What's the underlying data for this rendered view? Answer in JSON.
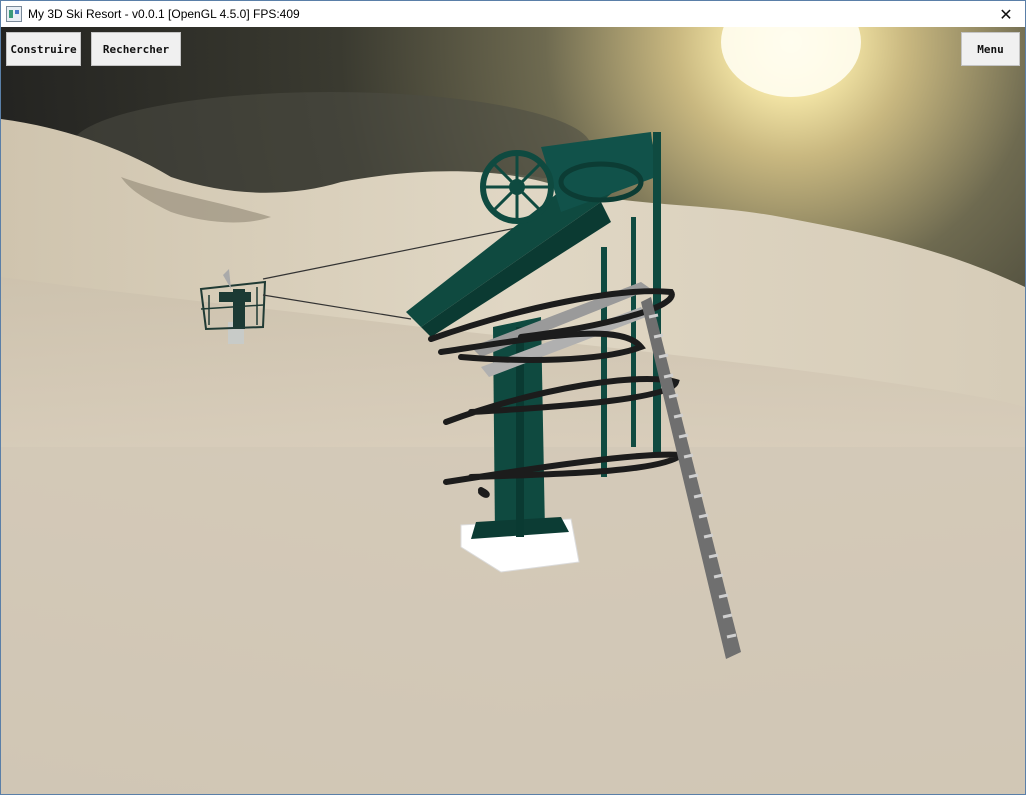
{
  "window": {
    "title": "My 3D Ski Resort - v0.0.1 [OpenGL 4.5.0] FPS:409",
    "icon": "app-icon",
    "close_glyph": "✕"
  },
  "hud": {
    "build_label": "Construire",
    "search_label": "Rechercher",
    "menu_label": "Menu"
  },
  "scene": {
    "colors": {
      "snow": "#d2c7b5",
      "sky_dark": "#2c2c24",
      "sun": "#fff8d8",
      "lift_green": "#0f4a40",
      "cable_black": "#1c1c1c",
      "ladder_gray": "#7a7a7a",
      "base_white": "#ffffff"
    }
  }
}
